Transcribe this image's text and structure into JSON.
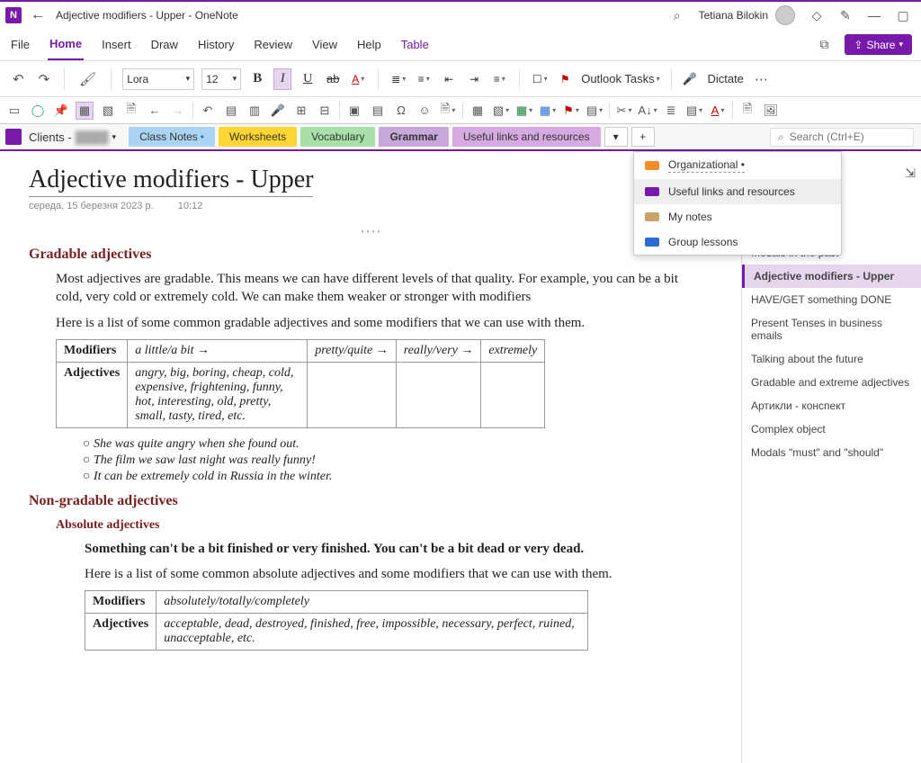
{
  "titlebar": {
    "app_glyph": "N",
    "title": "Adjective modifiers - Upper  -  OneNote",
    "user_name": "Tetiana Bilokin"
  },
  "menubar": {
    "items": [
      "File",
      "Home",
      "Insert",
      "Draw",
      "History",
      "Review",
      "View",
      "Help",
      "Table"
    ],
    "share": "Share"
  },
  "ribbon": {
    "font": "Lora",
    "size": "12",
    "outlook": "Outlook Tasks",
    "dictate": "Dictate"
  },
  "notebook": {
    "label": "Clients -"
  },
  "tabs": {
    "classnotes": "Class Notes",
    "worksheets": "Worksheets",
    "vocab": "Vocabulary",
    "grammar": "Grammar",
    "useful": "Useful links and resources"
  },
  "search": {
    "placeholder": "Search (Ctrl+E)"
  },
  "dropdown": {
    "organizational": "Organizational",
    "useful": "Useful links and resources",
    "mynotes": "My notes",
    "group": "Group lessons"
  },
  "pages": {
    "modals_past": "Modals in the past",
    "adj": "Adjective modifiers - Upper",
    "haveget": "HAVE/GET something DONE",
    "tenses": "Present Tenses in business emails",
    "future": "Talking about the future",
    "gradext": "Gradable and extreme adjectives",
    "articles": "Артикли - конспект",
    "complex": "Complex object",
    "modals_must": "Modals \"must\" and \"should\""
  },
  "doc": {
    "title": "Adjective modifiers - Upper",
    "date": "середа, 15 березня 2023 р.",
    "time": "10:12",
    "h_gradable": "Gradable adjectives",
    "p1": "Most adjectives are gradable. This means we can have different levels of that quality. For example, you can be a bit cold, very cold or extremely cold. We can make them weaker or stronger with modifiers",
    "p2": "Here is a list of some common gradable adjectives and some modifiers that we can use with them.",
    "t1": {
      "mod_label": "Modifiers",
      "adj_label": "Adjectives",
      "c1": "a little/a bit →",
      "c2": "pretty/quite →",
      "c3": "really/very →",
      "c4": "extremely",
      "adjs": "angry, big, boring, cheap, cold, expensive, frightening, funny, hot, interesting, old, pretty, small, tasty, tired, etc."
    },
    "ex1": "She was quite angry when she found out.",
    "ex2": "The film we saw last night was really funny!",
    "ex3": "It can be extremely cold in Russia in the winter.",
    "h_nongrad": "Non-gradable adjectives",
    "h_absolute": "Absolute adjectives",
    "p3": "Something can't be a bit finished or very finished. You can't be a bit dead or very dead.",
    "p4": "Here is a list of some common absolute adjectives and some modifiers that we can use with them.",
    "t2": {
      "mod_label": "Modifiers",
      "adj_label": "Adjectives",
      "mods": "absolutely/totally/completely",
      "adjs": "acceptable, dead, destroyed, finished, free, impossible, necessary, perfect, ruined, unacceptable, etc."
    }
  }
}
